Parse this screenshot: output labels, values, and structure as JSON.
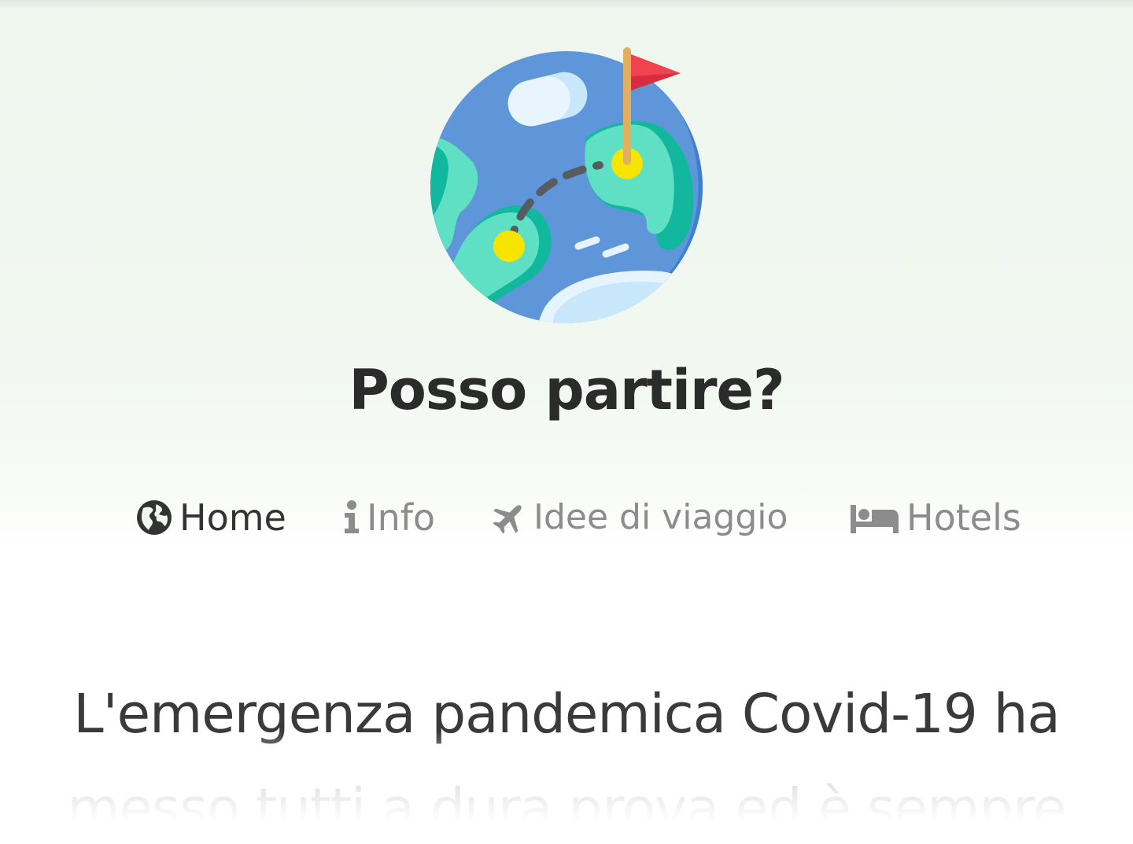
{
  "site": {
    "title": "Posso partire?",
    "logo_icon": "globe-travel-flag-icon"
  },
  "nav": {
    "items": [
      {
        "label": "Home",
        "icon": "globe-americas-icon",
        "active": true
      },
      {
        "label": "Info",
        "icon": "info-icon",
        "active": false
      },
      {
        "label": "Idee di viaggio",
        "icon": "plane-icon",
        "active": false
      },
      {
        "label": "Hotels",
        "icon": "bed-icon",
        "active": false
      }
    ]
  },
  "content": {
    "intro_text": "L'emergenza pandemica Covid-19 ha messo tutti a dura prova ed è sempre"
  },
  "colors": {
    "header_background": "#eef6ee",
    "title_text": "#2b2b2b",
    "nav_active": "#333333",
    "nav_inactive": "#8c8c8c",
    "globe_ocean": "#5b95d8",
    "globe_land": "#5fe0c4",
    "flag_red": "#f0434f",
    "marker_yellow": "#f7e400"
  }
}
